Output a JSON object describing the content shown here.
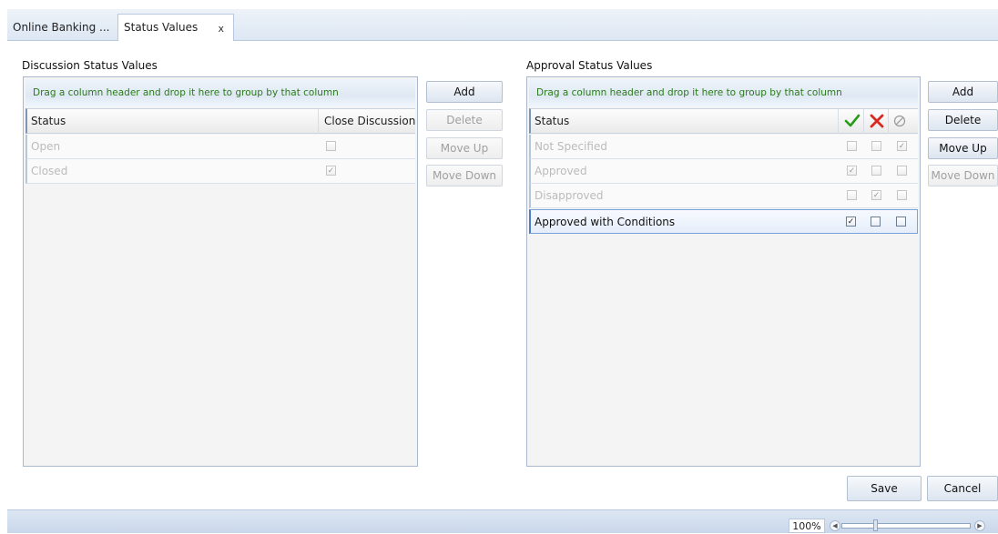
{
  "tabs": [
    {
      "label": "Online Banking ...",
      "active": false
    },
    {
      "label": "Status Values",
      "active": true,
      "close": "x"
    }
  ],
  "discussion": {
    "title": "Discussion Status Values",
    "group_hint": "Drag a column header and drop it here to group by that column",
    "columns": [
      "Status",
      "Close Discussion"
    ],
    "rows": [
      {
        "status": "Open",
        "close_discussion": false
      },
      {
        "status": "Closed",
        "close_discussion": true
      }
    ],
    "buttons": {
      "add": "Add",
      "delete": "Delete",
      "move_up": "Move Up",
      "move_down": "Move Down"
    }
  },
  "approval": {
    "title": "Approval Status Values",
    "group_hint": "Drag a column header and drop it here to group by that column",
    "columns": [
      "Status",
      "approve-check-icon",
      "disapprove-x-icon",
      "none-circle-icon"
    ],
    "rows": [
      {
        "status": "Not Specified",
        "approve": false,
        "disapprove": false,
        "none": true,
        "selected": false
      },
      {
        "status": "Approved",
        "approve": true,
        "disapprove": false,
        "none": false,
        "selected": false
      },
      {
        "status": "Disapproved",
        "approve": false,
        "disapprove": true,
        "none": false,
        "selected": false
      },
      {
        "status": "Approved with Conditions",
        "approve": true,
        "disapprove": false,
        "none": false,
        "selected": true
      }
    ],
    "buttons": {
      "add": "Add",
      "delete": "Delete",
      "move_up": "Move Up",
      "move_down": "Move Down"
    }
  },
  "footer": {
    "save": "Save",
    "cancel": "Cancel"
  },
  "zoom": {
    "label": "100%",
    "level_percent": 100
  },
  "colors": {
    "hint_text": "#2a7a1a",
    "check_green": "#2a9a1a",
    "x_red": "#d62a20",
    "selected_border": "#7aa3d9"
  }
}
